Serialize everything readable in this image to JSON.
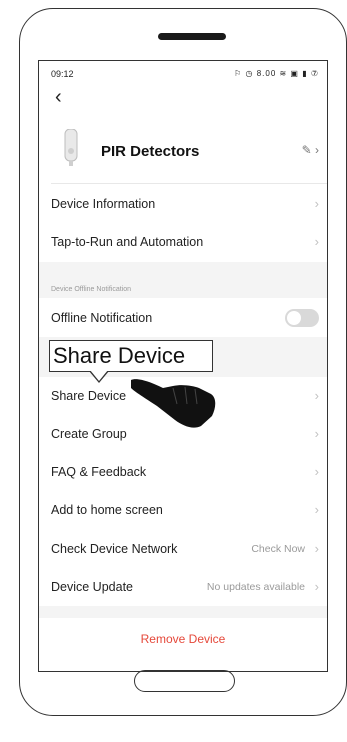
{
  "status_bar": {
    "time": "09:12",
    "icons": "⚐ ◷ 8.00 ≋ ▣ ▮ ⑦"
  },
  "header": {
    "back_icon": "chevron-left-icon",
    "device_name": "PIR Detectors",
    "edit_icon": "edit-icon"
  },
  "rows": {
    "device_information": "Device Information",
    "tap_to_run": "Tap-to-Run and Automation",
    "offline_section_label": "Device Offline Notification",
    "offline_notification": "Offline Notification",
    "share_device": "Share Device",
    "create_group": "Create Group",
    "faq": "FAQ & Feedback",
    "add_home": "Add to home screen",
    "check_network": "Check Device Network",
    "check_network_value": "Check Now",
    "device_update": "Device Update",
    "device_update_value": "No updates available"
  },
  "offline_toggle": {
    "on": false
  },
  "callout": {
    "text": "Share Device"
  },
  "remove_label": "Remove Device",
  "colors": {
    "remove": "#e5483a",
    "toggle_off": "#d9d9d9"
  }
}
